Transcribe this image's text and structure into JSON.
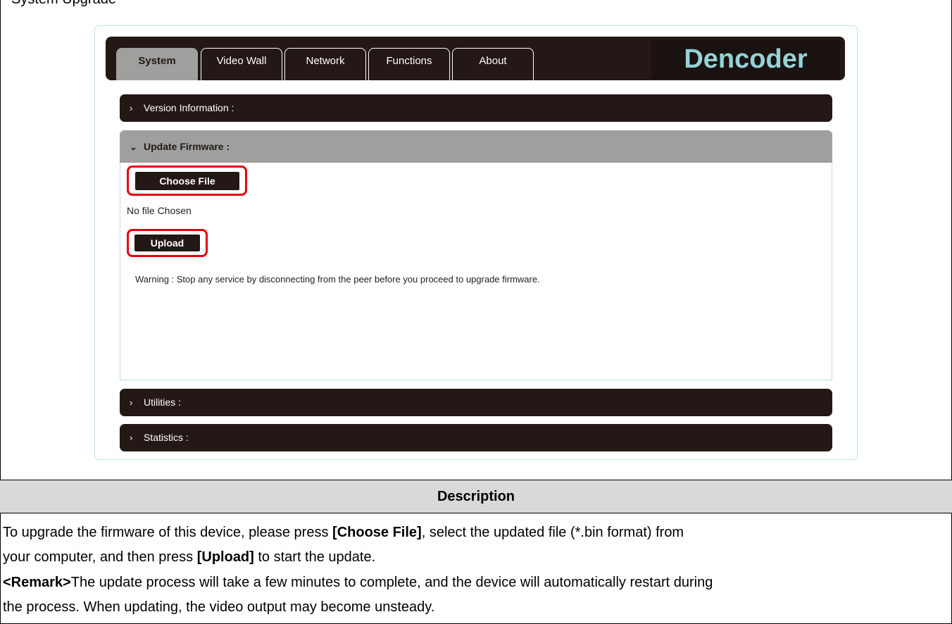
{
  "top_partial_text": "System Upgrade",
  "tabs": [
    {
      "label": "System",
      "active": true
    },
    {
      "label": "Video Wall",
      "active": false
    },
    {
      "label": "Network",
      "active": false
    },
    {
      "label": "Functions",
      "active": false
    },
    {
      "label": "About",
      "active": false
    }
  ],
  "brand": "Dencoder",
  "accordion": {
    "version_info": "Version Information :",
    "update_firmware": "Update Firmware :",
    "utilities": "Utilities :",
    "statistics": "Statistics :"
  },
  "firmware": {
    "choose_file_label": "Choose File",
    "file_status": "No file Chosen",
    "upload_label": "Upload",
    "warning": "Warning : Stop any service by disconnecting from the peer before you proceed to upgrade firmware."
  },
  "description": {
    "header": "Description",
    "line1_pre": "To upgrade the firmware of this device, please press ",
    "line1_bold1": "[Choose File]",
    "line1_post": ", select the updated file (*.bin format) from",
    "line2_pre": "your computer, and then press ",
    "line2_bold": "[Upload]",
    "line2_post": " to start the update.",
    "line3_bold": "<Remark>",
    "line3_post": "The update process will take a few minutes to complete, and the device will automatically restart during",
    "line4": "the process. When updating, the video output may become unsteady."
  },
  "colors": {
    "dark": "#231815",
    "active_tab": "#9ea09d",
    "brand_text": "#95d2d6",
    "highlight": "#e6000f"
  },
  "icons": {
    "collapsed": "chevron-right-icon",
    "expanded": "chevron-down-icon"
  }
}
